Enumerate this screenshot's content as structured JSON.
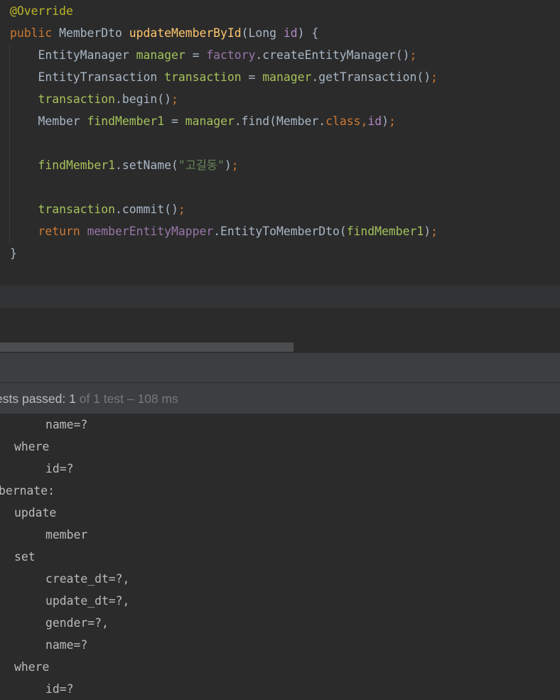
{
  "editor": {
    "lines": [
      [
        {
          "t": "@Override",
          "c": "ann"
        }
      ],
      [
        {
          "t": "public ",
          "c": "kw"
        },
        {
          "t": "MemberDto ",
          "c": "type"
        },
        {
          "t": "updateMemberById",
          "c": "fn"
        },
        {
          "t": "(",
          "c": "plain"
        },
        {
          "t": "Long ",
          "c": "type"
        },
        {
          "t": "id",
          "c": "param"
        },
        {
          "t": ") {",
          "c": "plain"
        }
      ],
      [
        {
          "t": "    EntityManager ",
          "c": "type"
        },
        {
          "t": "manager",
          "c": "local"
        },
        {
          "t": " = ",
          "c": "plain"
        },
        {
          "t": "factory",
          "c": "fld"
        },
        {
          "t": ".createEntityManager()",
          "c": "plain"
        },
        {
          "t": ";",
          "c": "punc"
        }
      ],
      [
        {
          "t": "    EntityTransaction ",
          "c": "type"
        },
        {
          "t": "transaction",
          "c": "local"
        },
        {
          "t": " = ",
          "c": "plain"
        },
        {
          "t": "manager",
          "c": "local"
        },
        {
          "t": ".getTransaction()",
          "c": "plain"
        },
        {
          "t": ";",
          "c": "punc"
        }
      ],
      [
        {
          "t": "    ",
          "c": "plain"
        },
        {
          "t": "transaction",
          "c": "local"
        },
        {
          "t": ".begin()",
          "c": "plain"
        },
        {
          "t": ";",
          "c": "punc"
        }
      ],
      [
        {
          "t": "    Member ",
          "c": "type"
        },
        {
          "t": "findMember1",
          "c": "local"
        },
        {
          "t": " = ",
          "c": "plain"
        },
        {
          "t": "manager",
          "c": "local"
        },
        {
          "t": ".find(Member.",
          "c": "plain"
        },
        {
          "t": "class",
          "c": "kw"
        },
        {
          "t": ",",
          "c": "punc"
        },
        {
          "t": "id",
          "c": "param"
        },
        {
          "t": ")",
          "c": "plain"
        },
        {
          "t": ";",
          "c": "punc"
        }
      ],
      [],
      [
        {
          "t": "    ",
          "c": "plain"
        },
        {
          "t": "findMember1",
          "c": "local"
        },
        {
          "t": ".setName(",
          "c": "plain"
        },
        {
          "t": "\"고길동\"",
          "c": "str"
        },
        {
          "t": ")",
          "c": "plain"
        },
        {
          "t": ";",
          "c": "punc"
        }
      ],
      [],
      [
        {
          "t": "    ",
          "c": "plain"
        },
        {
          "t": "transaction",
          "c": "local"
        },
        {
          "t": ".commit()",
          "c": "plain"
        },
        {
          "t": ";",
          "c": "punc"
        }
      ],
      [
        {
          "t": "    ",
          "c": "plain"
        },
        {
          "t": "return ",
          "c": "kw"
        },
        {
          "t": "memberEntityMapper",
          "c": "fld"
        },
        {
          "t": ".EntityToMemberDto(",
          "c": "plain"
        },
        {
          "t": "findMember1",
          "c": "local"
        },
        {
          "t": ")",
          "c": "plain"
        },
        {
          "t": ";",
          "c": "punc"
        }
      ],
      [
        {
          "t": "}",
          "c": "plain"
        }
      ]
    ]
  },
  "test_status": {
    "label": "ests passed: ",
    "passed": "1",
    "total_text": " of 1 test",
    "separator": " – ",
    "duration": "108 ms"
  },
  "console": {
    "lines": [
      {
        "text": "name=?",
        "level": 2
      },
      {
        "text": "where",
        "level": 1
      },
      {
        "text": "id=?",
        "level": 2
      },
      {
        "text": "bernate:",
        "level": 0
      },
      {
        "text": "update",
        "level": 1
      },
      {
        "text": "member",
        "level": 2
      },
      {
        "text": "set",
        "level": 1
      },
      {
        "text": "create_dt=?,",
        "level": 2
      },
      {
        "text": "update_dt=?,",
        "level": 2
      },
      {
        "text": "gender=?,",
        "level": 2
      },
      {
        "text": "name=?",
        "level": 2
      },
      {
        "text": "where",
        "level": 1
      },
      {
        "text": "id=?",
        "level": 2
      }
    ]
  }
}
